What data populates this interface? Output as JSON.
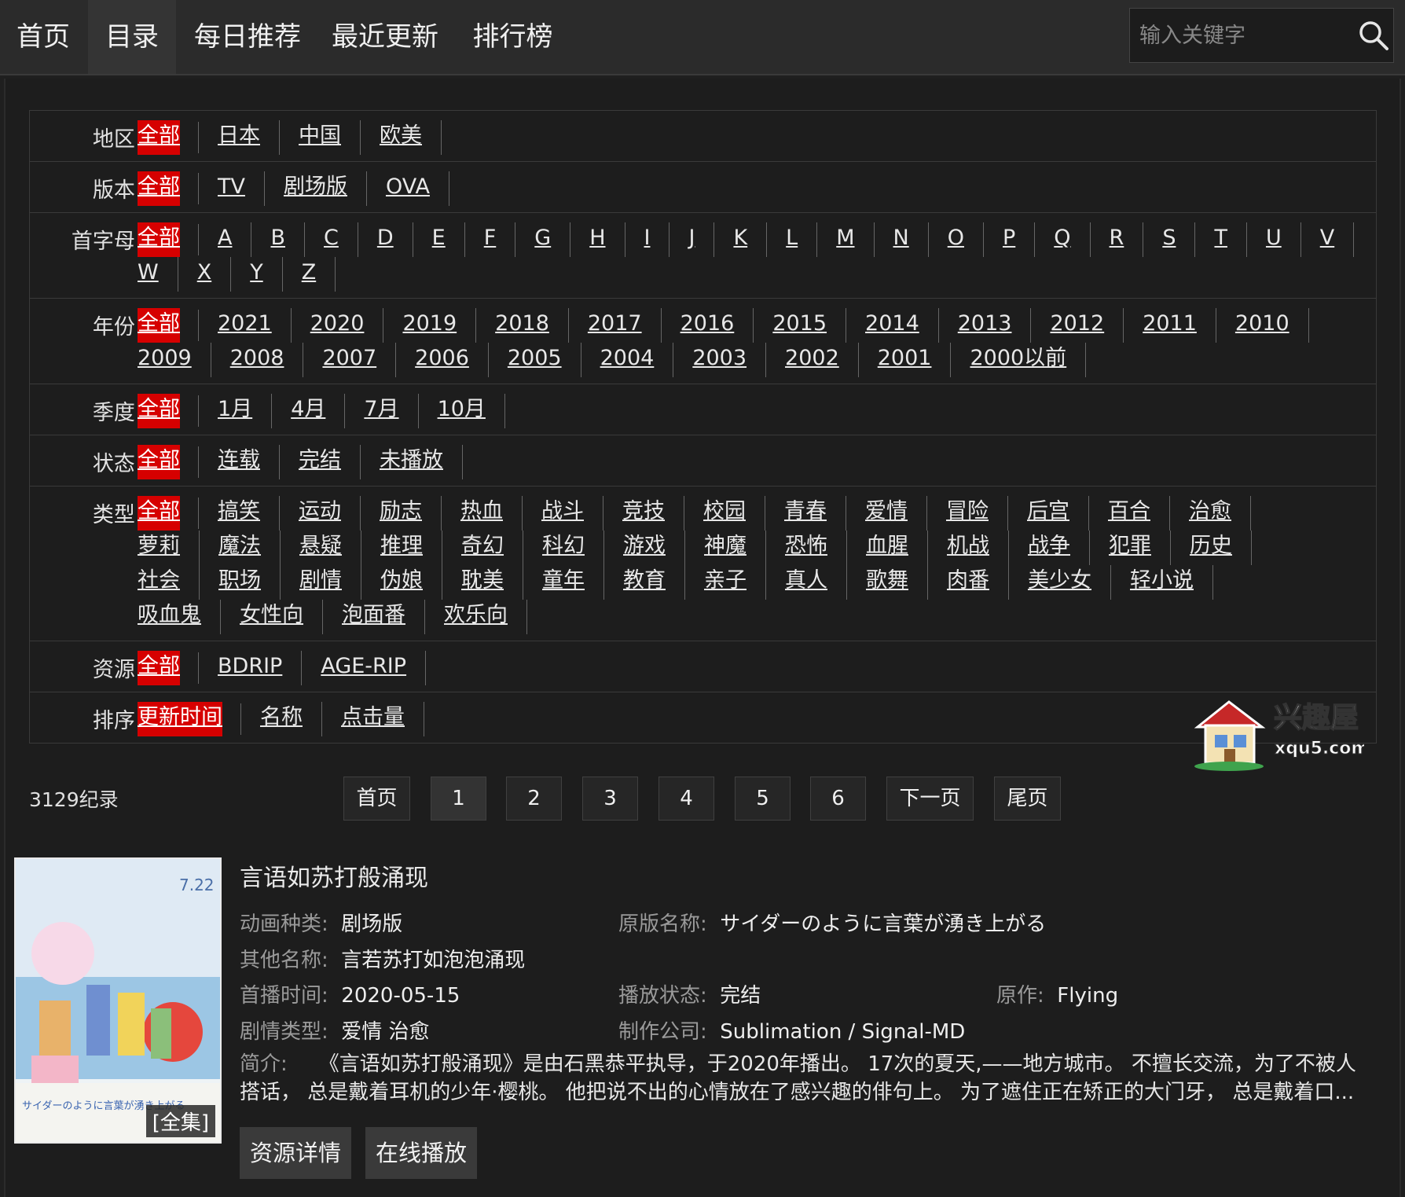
{
  "nav": {
    "items": [
      "首页",
      "目录",
      "每日推荐",
      "最近更新",
      "排行榜"
    ],
    "active_index": 1
  },
  "search": {
    "placeholder": "输入关键字",
    "icon": "search-icon"
  },
  "filters": [
    {
      "label": "地区:",
      "options": [
        "全部",
        "日本",
        "中国",
        "欧美"
      ]
    },
    {
      "label": "版本:",
      "options": [
        "全部",
        "TV",
        "剧场版",
        "OVA"
      ]
    },
    {
      "label": "首字母:",
      "options": [
        "全部",
        "A",
        "B",
        "C",
        "D",
        "E",
        "F",
        "G",
        "H",
        "I",
        "J",
        "K",
        "L",
        "M",
        "N",
        "O",
        "P",
        "Q",
        "R",
        "S",
        "T",
        "U",
        "V",
        "W",
        "X",
        "Y",
        "Z"
      ]
    },
    {
      "label": "年份:",
      "options": [
        "全部",
        "2021",
        "2020",
        "2019",
        "2018",
        "2017",
        "2016",
        "2015",
        "2014",
        "2013",
        "2012",
        "2011",
        "2010",
        "2009",
        "2008",
        "2007",
        "2006",
        "2005",
        "2004",
        "2003",
        "2002",
        "2001",
        "2000以前"
      ]
    },
    {
      "label": "季度:",
      "options": [
        "全部",
        "1月",
        "4月",
        "7月",
        "10月"
      ]
    },
    {
      "label": "状态:",
      "options": [
        "全部",
        "连载",
        "完结",
        "未播放"
      ]
    },
    {
      "label": "类型:",
      "options": [
        "全部",
        "搞笑",
        "运动",
        "励志",
        "热血",
        "战斗",
        "竞技",
        "校园",
        "青春",
        "爱情",
        "冒险",
        "后宫",
        "百合",
        "治愈",
        "萝莉",
        "魔法",
        "悬疑",
        "推理",
        "奇幻",
        "科幻",
        "游戏",
        "神魔",
        "恐怖",
        "血腥",
        "机战",
        "战争",
        "犯罪",
        "历史",
        "社会",
        "职场",
        "剧情",
        "伪娘",
        "耽美",
        "童年",
        "教育",
        "亲子",
        "真人",
        "歌舞",
        "肉番",
        "美少女",
        "轻小说",
        "吸血鬼",
        "女性向",
        "泡面番",
        "欢乐向"
      ]
    },
    {
      "label": "资源:",
      "options": [
        "全部",
        "BDRIP",
        "AGE-RIP"
      ]
    },
    {
      "label": "排序:",
      "options": [
        "更新时间",
        "名称",
        "点击量"
      ]
    }
  ],
  "watermark": {
    "brand": "兴趣屋",
    "site": "xqu5.com"
  },
  "results": {
    "count": "3129纪录"
  },
  "pagination": [
    "首页",
    "1",
    "2",
    "3",
    "4",
    "5",
    "6",
    "下一页",
    "尾页"
  ],
  "item": {
    "title": "言语如苏打般涌现",
    "badge": "[全集]",
    "fields": {
      "type_k": "动画种类:",
      "type_v": "剧场版",
      "orig_k": "原版名称:",
      "orig_v": "サイダーのように言葉が湧き上がる",
      "alias_k": "其他名称:",
      "alias_v": "言若苏打如泡泡涌现",
      "date_k": "首播时间:",
      "date_v": "2020-05-15",
      "status_k": "播放状态:",
      "status_v": "完结",
      "src_k": "原作:",
      "src_v": "Flying",
      "genre_k": "剧情类型:",
      "genre_v": "爱情 治愈",
      "studio_k": "制作公司:",
      "studio_v": "Sublimation / Signal-MD"
    },
    "desc_k": "简介:",
    "desc_v": "《言语如苏打般涌现》是由石黑恭平执导，于2020年播出。 17次的夏天,——地方城市。 不擅长交流，为了不被人搭话， 总是戴着耳机的少年·樱桃。 他把说不出的心情放在了感兴趣的俳句上。 为了遮住正在矫正的大门牙， 总是戴着口...",
    "buttons": [
      "资源详情",
      "在线播放"
    ],
    "poster_text": {
      "date": "7.22",
      "title": "サイダーのように言葉が湧き上がる"
    }
  }
}
